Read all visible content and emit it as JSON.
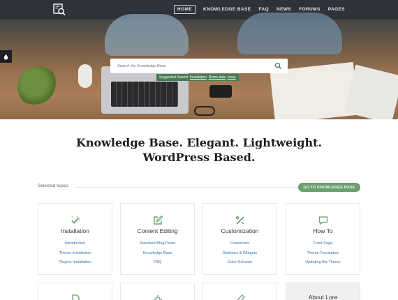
{
  "nav": {
    "items": [
      "HOME",
      "KNOWLEDGE BASE",
      "FAQ",
      "NEWS",
      "FORUMS",
      "PAGES"
    ],
    "active": "HOME"
  },
  "search": {
    "placeholder": "Search the Knowledge Base",
    "suggested_label": "Suggested Search:",
    "suggested_links": [
      "Installation",
      "Demo data",
      "Icons"
    ]
  },
  "headline": {
    "line1": "Knowledge Base. Elegant. Lightweight.",
    "line2": "WordPress Based."
  },
  "topics": {
    "label": "Selected topics",
    "button": "GO TO KNOWLEDGE BASE",
    "cards": [
      {
        "title": "Installation",
        "icon": "tools-check-icon",
        "links": [
          "Introduction",
          "Theme Installation",
          "Plugins Installation"
        ]
      },
      {
        "title": "Content Editing",
        "icon": "edit-icon",
        "links": [
          "Standard Blog Posts",
          "Knowledge Base",
          "FAQ"
        ]
      },
      {
        "title": "Customization",
        "icon": "wrench-pencil-icon",
        "links": [
          "Customizer",
          "Sidebars & Widgets",
          "Color Scheme"
        ]
      },
      {
        "title": "How To",
        "icon": "chat-bubble-icon",
        "links": [
          "Front Page",
          "Theme Translation",
          "Updating the Theme"
        ]
      }
    ]
  },
  "about": {
    "title": "About Lore"
  },
  "colors": {
    "accent": "#6a9f6e",
    "link": "#3e74a8",
    "nav_bg": "#2f3238"
  }
}
